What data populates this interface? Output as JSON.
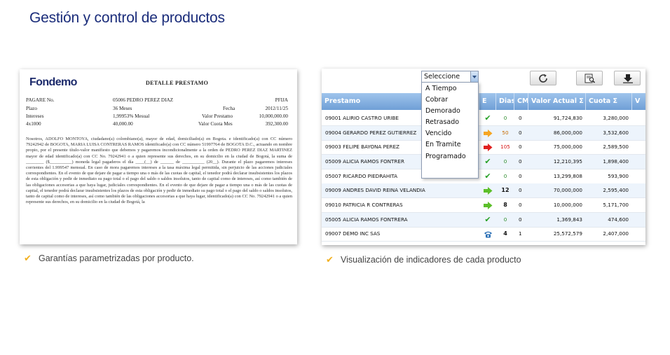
{
  "page": {
    "title": "Gestión y control de productos"
  },
  "document": {
    "logo": "Fondemo",
    "heading": "DETALLE PRESTAMO",
    "rows": [
      {
        "label": "PAGARE No.",
        "value": "05006 PEDRO PEREZ DIAZ",
        "label2": "",
        "value2": "PFIJA"
      },
      {
        "label": "Plazo",
        "value": "36 Meses",
        "label2": "Fecha",
        "value2": "2012/11/25"
      },
      {
        "label": "Intereses",
        "value": "1,99953% Mesual",
        "label2": "Valor Prestamo",
        "value2": "10,000,000.00"
      },
      {
        "label": "4x1000",
        "value": "40,000.00",
        "label2": "Valor Cuota Mes",
        "value2": "392,300.00"
      }
    ],
    "body": "Nosotros, ADOLFO MONTOYA, ciudadano(a) colombiano(a), mayor de edad, domiciliado(a) en Bogota. e identificado(a) con CC número 79242942 de BOGOTA, MARIA LUISA CONTRERAS RAMOS identificado(a) con CC número 51997764 de BOGOTA D.C., actuando en nombre propio, por el presente título-valor manifiesto que debemos y pagaremos incondicionalmente a la orden de PEDRO PEREZ DIAZ MARTINEZ mayor de edad identificado(a) con CC No. 79242941 o a quien represente sus derechos, en su domicilio en la ciudad de Bogotá, la suma de ________ ($__________) moneda legal pagaderos el día ____(__) de ______ de __________ (20__). Durante el plazo pagaremos intereses corrientes del 1.999547 mensual. En caso de mora pagaremos intereses a la tasa máxima legal permitida, sin perjuicio de las acciones judiciales correspondientes. En el evento de que dejare de pagar a tiempo una o más de las cuotas de capital, el tenedor podrá declarar insubsistentes los plazos de esta obligación y pedir de inmediato su pago total o el pago del saldo o saldos insolutos, tanto de capital como de intereses, así como también de las obligaciones accesorias a que haya lugar, judiciales correspondientes. En el evento de que dejare de pagar a tiempo una o más de las cuotas de capital, el tenedor podrá declarar insubsistentes los plazos de esta obligación y pedir de inmediato su pago total o el pago del saldo o saldos insolutos, tanto de capital como de intereses, así como también de las obligaciones accesorias a que haya lugar, identificado(a) con CC No. 79242941 o a quien represente sus derechos, en su domicilio en la ciudad de Bogotá, la"
  },
  "captions": {
    "left": "Garantías parametrizadas por producto.",
    "right": "Visualización de indicadores de cada producto"
  },
  "toolbar": {
    "icons": [
      "refresh-icon",
      "search-document-icon",
      "download-icon"
    ]
  },
  "dropdown": {
    "selected": "Seleccione",
    "options": [
      "A Tiempo",
      "Cobrar",
      "Demorado",
      "Retrasado",
      "Vencido",
      "En Tramite",
      "Programado"
    ]
  },
  "grid": {
    "headers": {
      "prestamo": "Prestamo",
      "e": "E",
      "dias": "Dias",
      "cm": "CM",
      "valor": "Valor Actual Σ",
      "cuota": "Cuota Σ",
      "extra": "V"
    },
    "rows": [
      {
        "name": "09001 ALIRIO CASTRO URIBE",
        "indicator": "check",
        "days": "0",
        "cm": "0",
        "valor": "91,724,830",
        "cuota": "3,280,000"
      },
      {
        "name": "09004 GERARDO PEREZ GUTIERREZ",
        "indicator": "arrow-orange",
        "days": "50",
        "cm": "0",
        "valor": "86,000,000",
        "cuota": "3,532,600"
      },
      {
        "name": "09003 FELIPE BAYONA PEREZ",
        "indicator": "arrow-red",
        "days": "105",
        "cm": "0",
        "valor": "75,000,000",
        "cuota": "2,589,500"
      },
      {
        "name": "05009 ALICIA RAMOS FONTRER",
        "indicator": "check",
        "days": "0",
        "cm": "0",
        "valor": "12,210,395",
        "cuota": "1,898,400"
      },
      {
        "name": "05007 RICARDO PIEDRAHITA",
        "indicator": "check",
        "days": "0",
        "cm": "0",
        "valor": "13,299,808",
        "cuota": "593,900"
      },
      {
        "name": "09009 ANDRES DAVID REINA VELANDIA",
        "indicator": "arrow-green",
        "days": "12",
        "cm": "0",
        "valor": "70,000,000",
        "cuota": "2,595,400"
      },
      {
        "name": "09010 PATRICIA R  CONTRERAS",
        "indicator": "arrow-green",
        "days": "8",
        "cm": "0",
        "valor": "10,000,000",
        "cuota": "5,171,700"
      },
      {
        "name": "05005 ALICIA RAMOS FONTRERA",
        "indicator": "check",
        "days": "0",
        "cm": "0",
        "valor": "1,369,843",
        "cuota": "474,600"
      },
      {
        "name": "09007 DEMO INC SAS",
        "indicator": "phone",
        "days": "4",
        "cm": "1",
        "valor": "25,572,579",
        "cuota": "2,407,000"
      }
    ]
  },
  "colors": {
    "title": "#1a2c7a",
    "header_top": "#9fc4ec",
    "header_bottom": "#6f9fd6",
    "check": "#f2b01e"
  }
}
